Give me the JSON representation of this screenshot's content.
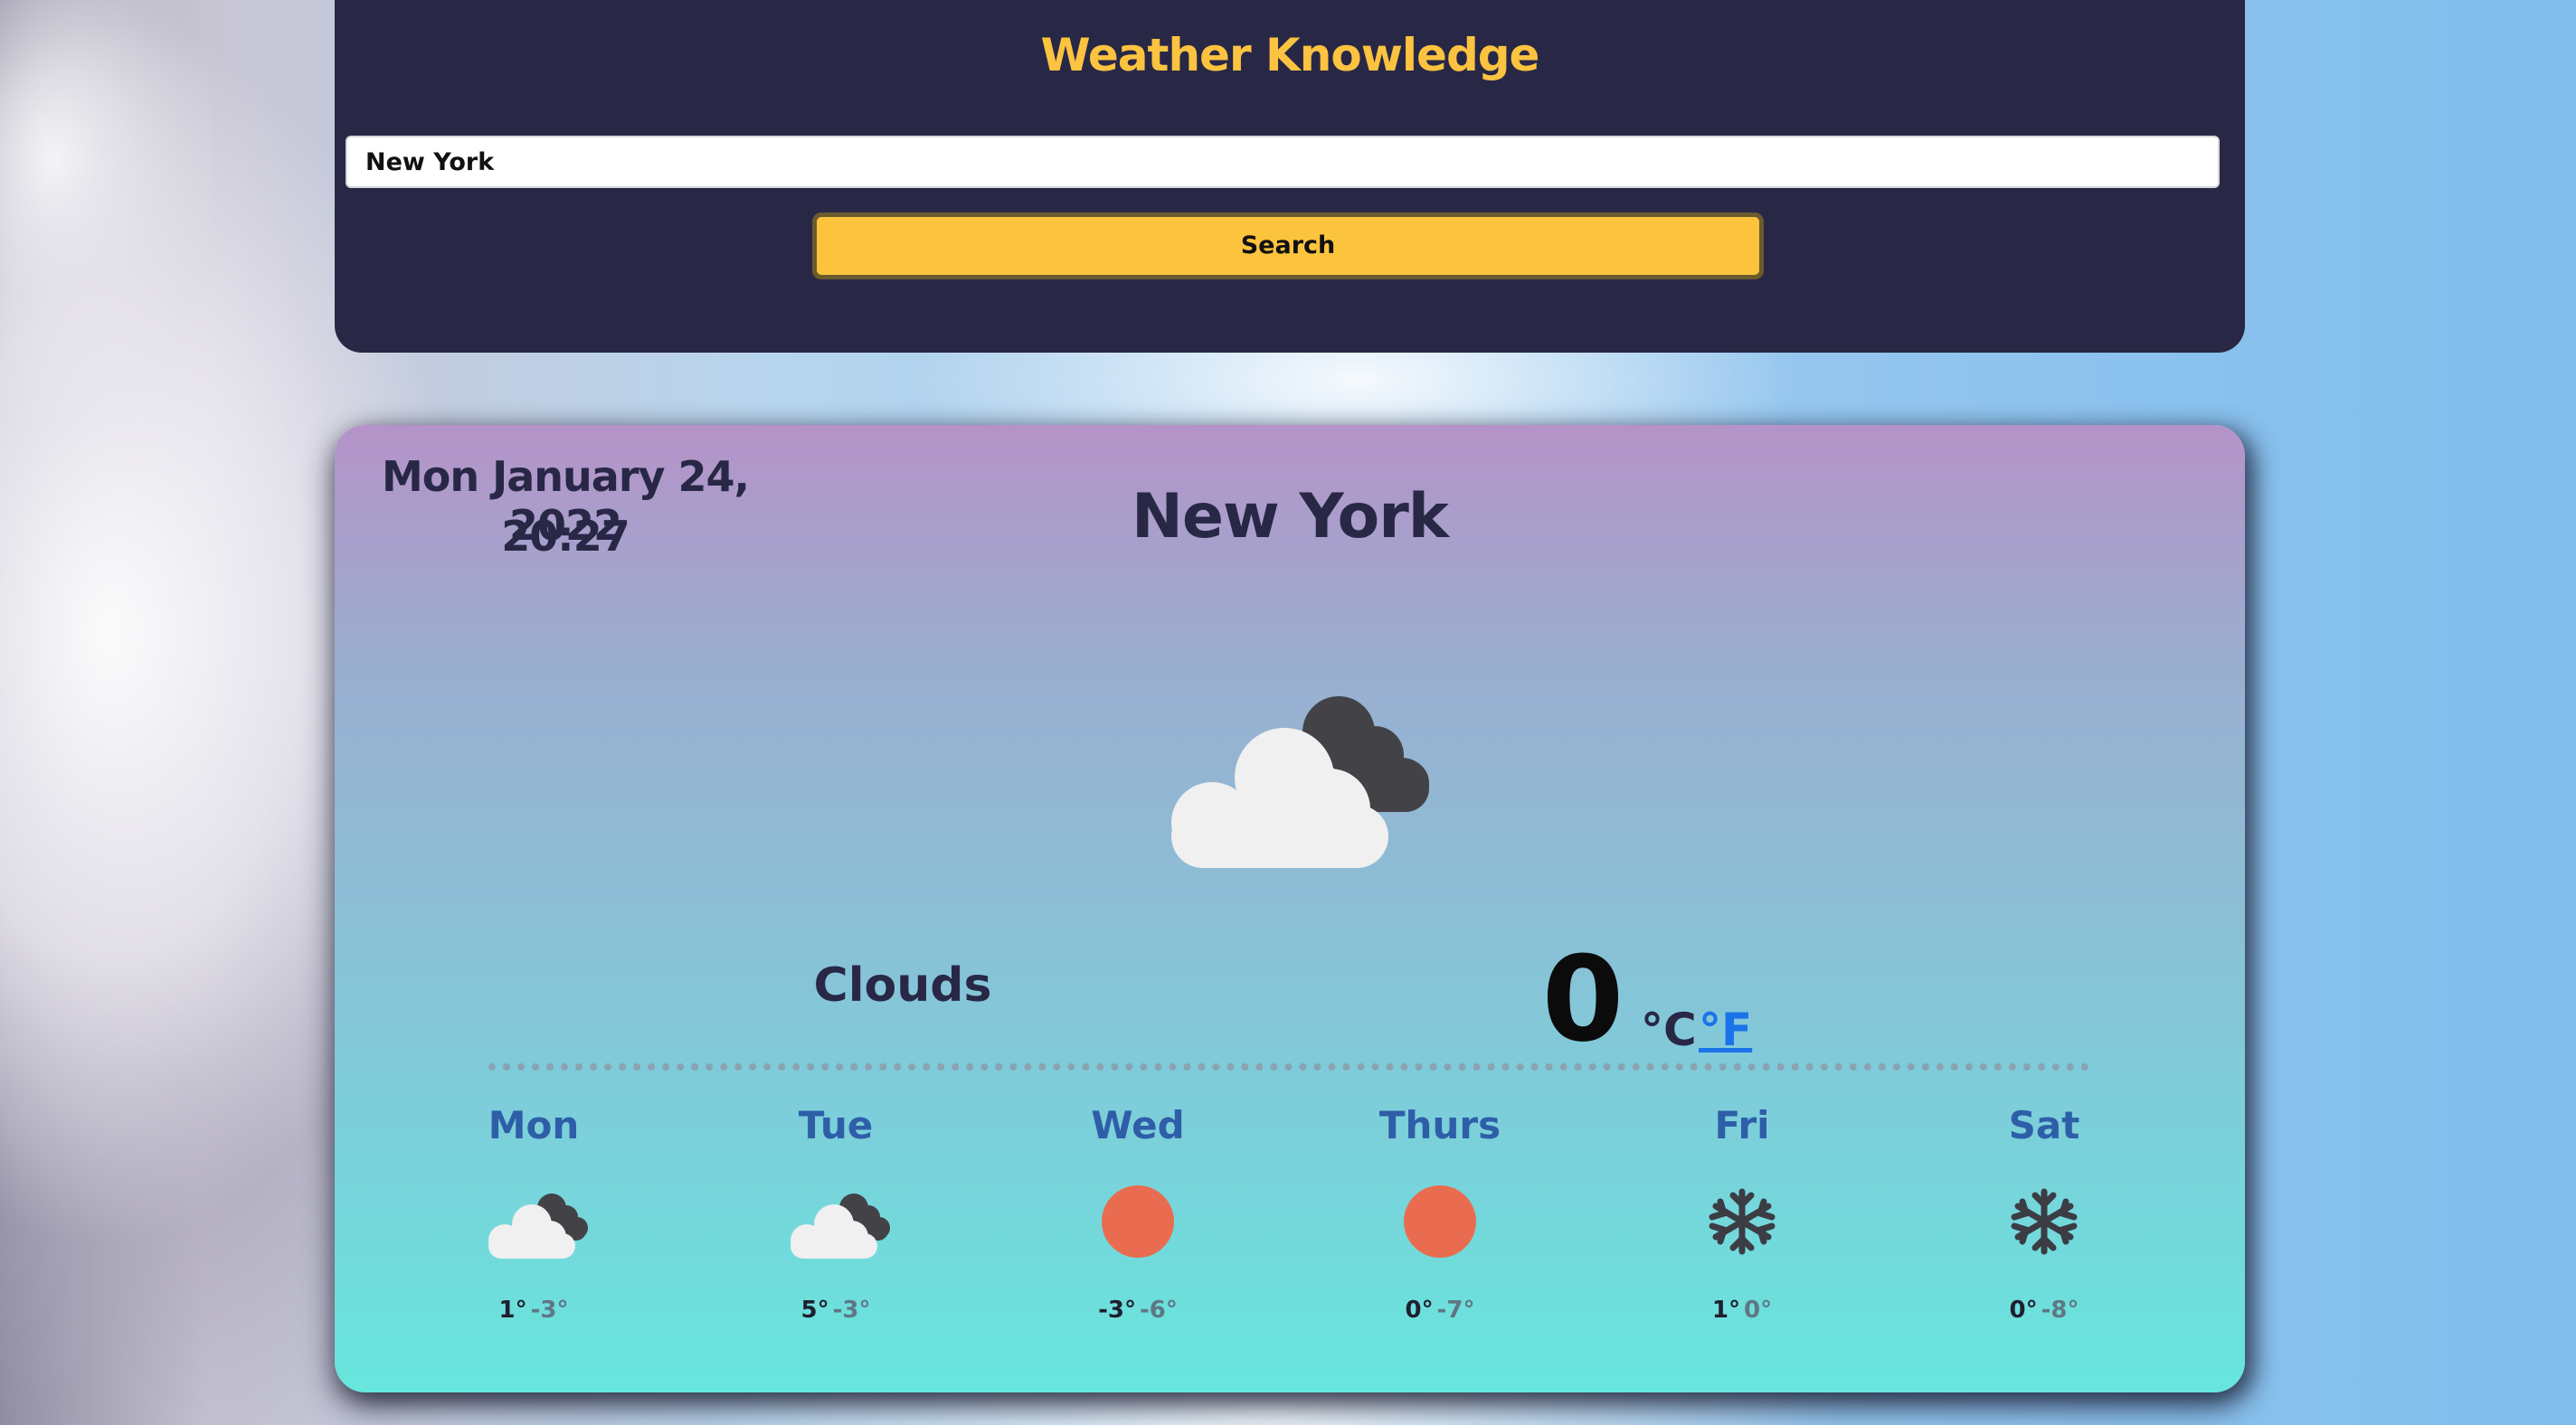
{
  "header": {
    "title": "Weather Knowledge",
    "search_value": "New York",
    "search_label": "Search"
  },
  "current": {
    "date": "Mon January 24, 2022",
    "time": "20:27",
    "city": "New York",
    "icon": "clouds-icon",
    "condition": "Clouds",
    "temperature": "0",
    "unit_celsius": "°C",
    "unit_fahrenheit": "°F"
  },
  "forecast": [
    {
      "day": "Mon",
      "icon": "clouds-icon",
      "max": "1°",
      "min": "-3°"
    },
    {
      "day": "Tue",
      "icon": "clouds-icon",
      "max": "5°",
      "min": "-3°"
    },
    {
      "day": "Wed",
      "icon": "sun-icon",
      "max": "-3°",
      "min": "-6°"
    },
    {
      "day": "Thurs",
      "icon": "sun-icon",
      "max": "0°",
      "min": "-7°"
    },
    {
      "day": "Fri",
      "icon": "snowflake-icon",
      "max": "1°",
      "min": "0°"
    },
    {
      "day": "Sat",
      "icon": "snowflake-icon",
      "max": "0°",
      "min": "-8°"
    }
  ],
  "colors": {
    "panel": "#282846",
    "accent": "#fcc340",
    "day_label": "#2f5ea8",
    "sun": "#e96c50",
    "link": "#1a73e8"
  }
}
